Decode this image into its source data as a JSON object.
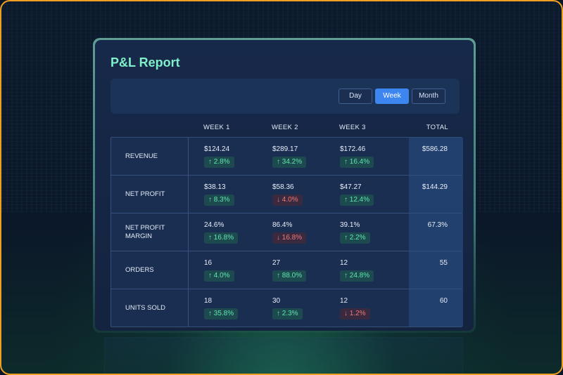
{
  "report": {
    "title": "P&L Report",
    "periods": [
      {
        "label": "Day",
        "active": false
      },
      {
        "label": "Week",
        "active": true
      },
      {
        "label": "Month",
        "active": false
      }
    ],
    "columns": [
      "WEEK 1",
      "WEEK 2",
      "WEEK 3",
      "TOTAL"
    ],
    "rows": [
      {
        "label": "REVENUE",
        "cells": [
          {
            "value": "$124.24",
            "change": "↑ 2.8%",
            "dir": "up"
          },
          {
            "value": "$289.17",
            "change": "↑ 34.2%",
            "dir": "up"
          },
          {
            "value": "$172.46",
            "change": "↑ 16.4%",
            "dir": "up"
          }
        ],
        "total": "$586.28"
      },
      {
        "label": "NET PROFIT",
        "cells": [
          {
            "value": "$38.13",
            "change": "↑ 8.3%",
            "dir": "up"
          },
          {
            "value": "$58.36",
            "change": "↓ 4.0%",
            "dir": "down"
          },
          {
            "value": "$47.27",
            "change": "↑ 12.4%",
            "dir": "up"
          }
        ],
        "total": "$144.29"
      },
      {
        "label": "NET PROFIT MARGIN",
        "cells": [
          {
            "value": "24.6%",
            "change": "↑ 16.8%",
            "dir": "up"
          },
          {
            "value": "86.4%",
            "change": "↓ 16.8%",
            "dir": "down"
          },
          {
            "value": "39.1%",
            "change": "↑ 2.2%",
            "dir": "up"
          }
        ],
        "total": "67.3%"
      },
      {
        "label": "ORDERS",
        "cells": [
          {
            "value": "16",
            "change": "↑ 4.0%",
            "dir": "up"
          },
          {
            "value": "27",
            "change": "↑ 88.0%",
            "dir": "up"
          },
          {
            "value": "12",
            "change": "↑ 24.8%",
            "dir": "up"
          }
        ],
        "total": "55"
      },
      {
        "label": "UNITS SOLD",
        "cells": [
          {
            "value": "18",
            "change": "↑ 35.8%",
            "dir": "up"
          },
          {
            "value": "30",
            "change": "↑ 2.3%",
            "dir": "up"
          },
          {
            "value": "12",
            "change": "↓ 1.2%",
            "dir": "down"
          }
        ],
        "total": "60"
      }
    ]
  },
  "colors": {
    "accent": "#3d86f0",
    "title": "#7ff0c8",
    "up": "#5ee6b0",
    "down": "#f07878",
    "frame": "#f0a020"
  }
}
